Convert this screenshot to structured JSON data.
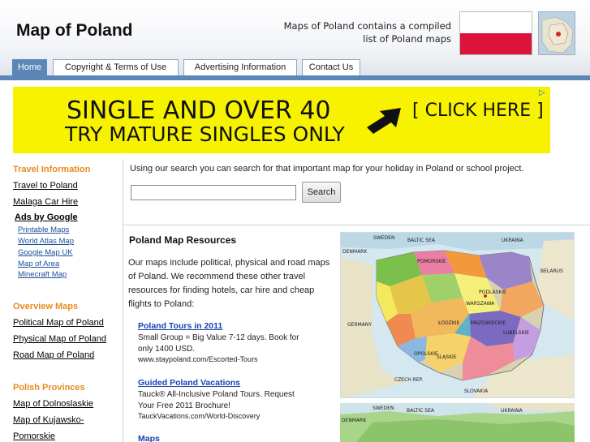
{
  "header": {
    "site_title": "Map of Poland",
    "tagline": "Maps of Poland contains a compiled list of Poland maps",
    "flag_colors": [
      "#ffffff",
      "#dc143c"
    ]
  },
  "nav": {
    "tabs": [
      {
        "label": "Home",
        "active": true
      },
      {
        "label": "Copyright & Terms of Use",
        "active": false
      },
      {
        "label": "Advertising Information",
        "active": false
      },
      {
        "label": "Contact Us",
        "active": false
      }
    ]
  },
  "banner": {
    "line1": "SINGLE AND OVER 40",
    "line2": "TRY MATURE SINGLES ONLY",
    "cta": "[ CLICK HERE ]",
    "background": "#f6f200"
  },
  "sidebar": {
    "travel_heading": "Travel Information",
    "travel_links": [
      "Travel to Poland",
      "Malaga Car Hire"
    ],
    "ads_label": "Ads by Google",
    "ad_links": [
      "Printable Maps",
      "World Atlas Map",
      "Google Map UK",
      "Map of Area",
      "Minecraft Map"
    ],
    "overview_heading": "Overview Maps",
    "overview_links": [
      "Political Map of Poland",
      "Physical Map of Poland",
      "Road Map of Poland"
    ],
    "provinces_heading": "Polish Provinces",
    "province_links": [
      "Map of Dolnoslaskie",
      "Map of Kujawsko-",
      "Pomorskie"
    ],
    "heading_color": "#e98a1f"
  },
  "search": {
    "description": "Using our search you can search for that important map for your holiday in Poland or school project.",
    "button_label": "Search",
    "value": ""
  },
  "main": {
    "title": "Poland Map Resources",
    "intro": "Our maps include political, physical and road maps of Poland. We recommend these other travel resources for finding hotels, car hire and cheap flights to Poland:",
    "ads": [
      {
        "title": "Poland Tours in 2011",
        "desc": "Small Group = Big Value 7-12 days. Book for only 1400 USD.",
        "url": "www.staypoland.com/Escorted-Tours"
      },
      {
        "title": "Guided Poland Vacations",
        "desc": "Tauck® All-Inclusive Poland Tours. Request Your Free 2011 Brochure!",
        "url": "TauckVacations.com/World-Discovery"
      },
      {
        "title": "Maps",
        "desc": "",
        "url": ""
      }
    ]
  },
  "map_labels": {
    "baltic": "BALTIC SEA",
    "ukraine": "UKRAINA",
    "belarus": "BELARUS",
    "germany": "GERMANY",
    "czech": "CZECH REP.",
    "slovakia": "SLOVAKIA",
    "sweden": "SWEDEN",
    "denmark": "DENMARK",
    "warszawa": "WARSZAWA",
    "pomorskie": "POMORSKIE",
    "mazowieckie": "MAZOWIECKIE",
    "lodzkie": "ŁÓDZKIE",
    "slaskie": "ŚLĄSKIE",
    "lubelskie": "LUBELSKIE",
    "podlaskie": "PODLASKIE",
    "opolskie": "OPOLSKIE"
  }
}
